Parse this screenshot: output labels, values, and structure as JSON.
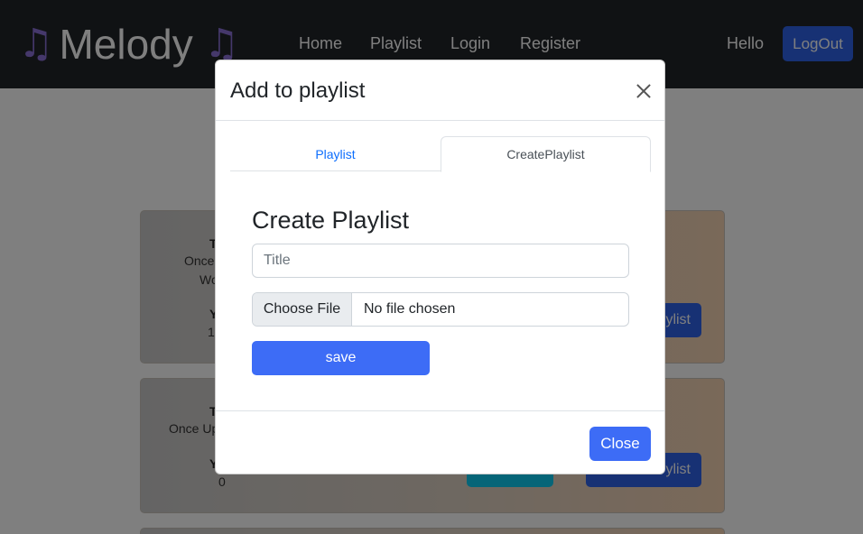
{
  "navbar": {
    "brand": "Melody",
    "brand_icon": "music-notes-icon",
    "links": [
      "Home",
      "Playlist",
      "Login",
      "Register"
    ],
    "greeting": "Hello",
    "logout_label": "LogOut"
  },
  "background": {
    "cards": [
      {
        "title_fragment": "T",
        "line1": "Once",
        "line2": "Wo",
        "year_fragment": "Y",
        "count": "1",
        "button_fragment": "ylist"
      },
      {
        "title_fragment": "T",
        "line1": "Once Up",
        "year_fragment": "Y",
        "count": "0",
        "button_fragment": "ylist"
      }
    ]
  },
  "modal": {
    "title": "Add to playlist",
    "tabs": [
      "Playlist",
      "CreatePlaylist"
    ],
    "active_tab": "CreatePlaylist",
    "form_heading": "Create Playlist",
    "title_placeholder": "Title",
    "file_button": "Choose File",
    "file_status": "No file chosen",
    "save_label": "save",
    "close_label": "Close"
  },
  "colors": {
    "navbar_bg": "#212529",
    "brand_icon": "#8a70d6",
    "primary": "#3d6cf6",
    "link": "#0d6efd"
  }
}
